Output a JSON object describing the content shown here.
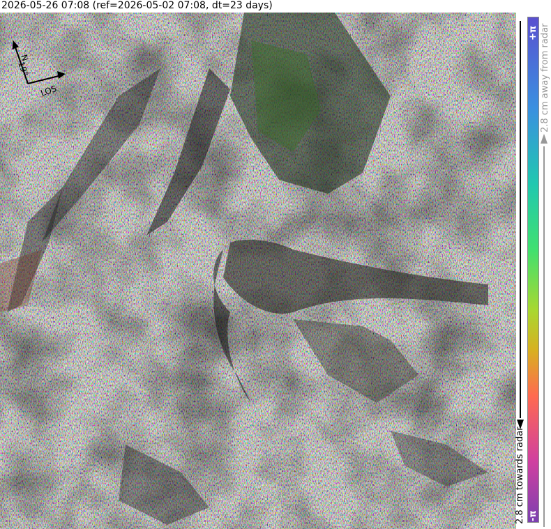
{
  "title": "2026-05-26 07:08 (ref=2026-05-02 07:08, dt=23 days)",
  "compass": {
    "north_label": "N",
    "heading_label": "19°",
    "los_label": "LOS"
  },
  "colorbar": {
    "top_symbol": "+π",
    "bottom_symbol": "-π",
    "away_label": "2.8 cm away from radar",
    "towards_label": "2.8 cm towards radar",
    "colors": [
      "#7b3fb0",
      "#d040a0",
      "#ff6a50",
      "#d8b020",
      "#a8d830",
      "#40e070",
      "#20c8b0",
      "#3a90e0",
      "#5a50d0"
    ]
  }
}
